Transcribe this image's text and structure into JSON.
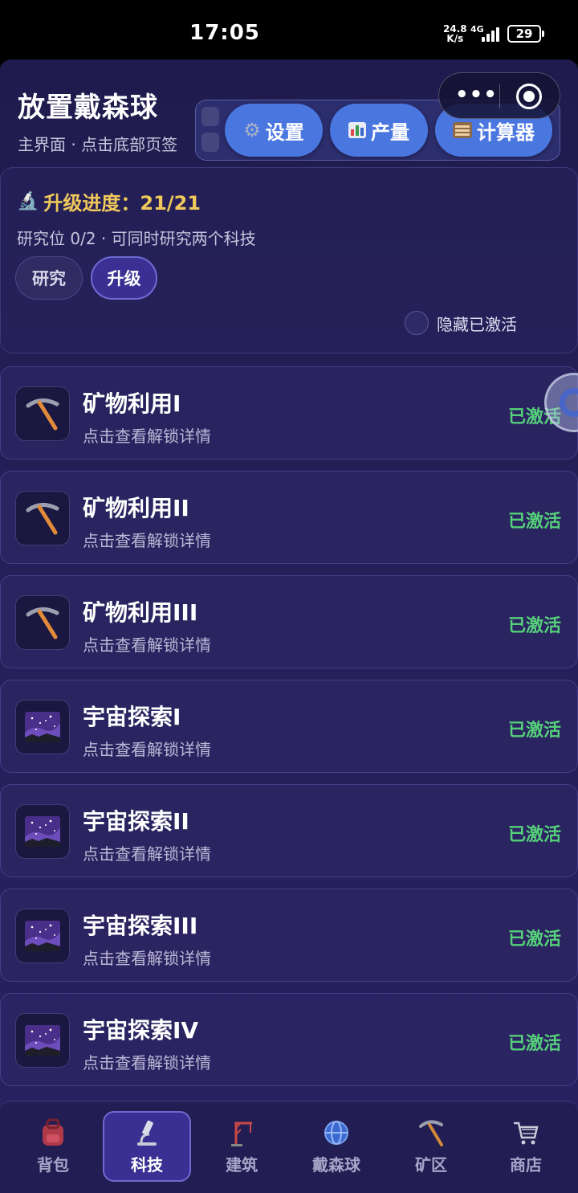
{
  "status_bar": {
    "time": "17:05",
    "net_speed_value": "24.8",
    "net_speed_unit": "K/s",
    "network": "4G",
    "battery": "29"
  },
  "header": {
    "title": "放置戴森球",
    "subtitle": "主界面 · 点击底部页签"
  },
  "toolbar": {
    "settings_label": "设置",
    "production_label": "产量",
    "calculator_label": "计算器"
  },
  "upgrade_panel": {
    "progress_label": "升级进度：21/21",
    "research_info": "研究位 0/2 · 可同时研究两个科技",
    "tabs": [
      {
        "label": "研究",
        "active": false
      },
      {
        "label": "升级",
        "active": true
      }
    ],
    "hide_toggle_label": "隐藏已激活"
  },
  "tech_items": [
    {
      "name": "矿物利用I",
      "hint": "点击查看解锁详情",
      "status": "已激活",
      "icon": "pickaxe-icon"
    },
    {
      "name": "矿物利用II",
      "hint": "点击查看解锁详情",
      "status": "已激活",
      "icon": "pickaxe-icon"
    },
    {
      "name": "矿物利用III",
      "hint": "点击查看解锁详情",
      "status": "已激活",
      "icon": "pickaxe-icon"
    },
    {
      "name": "宇宙探索I",
      "hint": "点击查看解锁详情",
      "status": "已激活",
      "icon": "milky-way-icon"
    },
    {
      "name": "宇宙探索II",
      "hint": "点击查看解锁详情",
      "status": "已激活",
      "icon": "milky-way-icon"
    },
    {
      "name": "宇宙探索III",
      "hint": "点击查看解锁详情",
      "status": "已激活",
      "icon": "milky-way-icon"
    },
    {
      "name": "宇宙探索IV",
      "hint": "点击查看解锁详情",
      "status": "已激活",
      "icon": "milky-way-icon"
    }
  ],
  "bottom_nav": [
    {
      "label": "背包",
      "icon": "backpack-icon",
      "active": false
    },
    {
      "label": "科技",
      "icon": "microscope-icon",
      "active": true
    },
    {
      "label": "建筑",
      "icon": "crane-icon",
      "active": false
    },
    {
      "label": "戴森球",
      "icon": "globe-icon",
      "active": false
    },
    {
      "label": "矿区",
      "icon": "pickaxe-icon",
      "active": false
    },
    {
      "label": "商店",
      "icon": "shopping-cart-icon",
      "active": false
    }
  ],
  "colors": {
    "accent_blue": "#4a76e0",
    "gold": "#f0c95a",
    "active_green": "#55d07a",
    "background": "#251f58"
  }
}
